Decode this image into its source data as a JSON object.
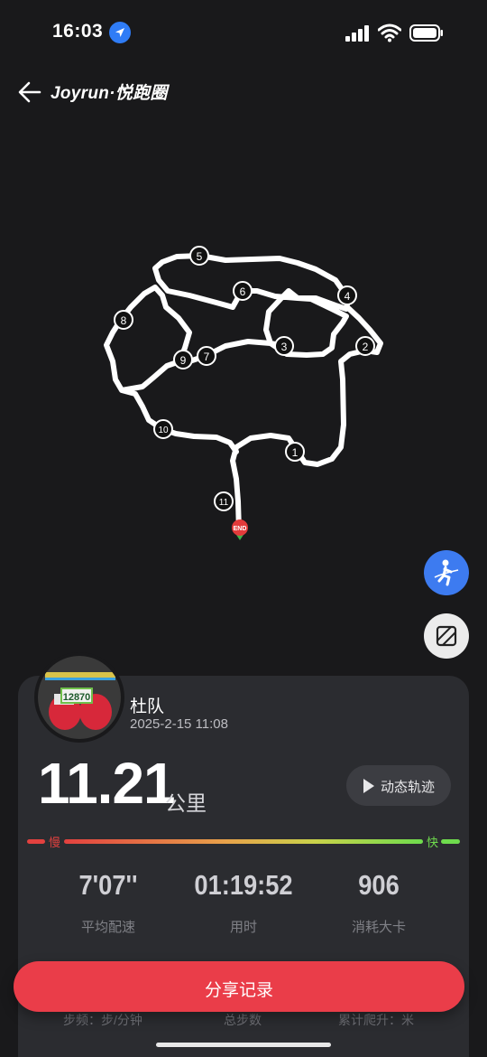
{
  "status": {
    "time": "16:03"
  },
  "nav": {
    "title": "Joyrun·悦跑圈"
  },
  "map": {
    "markers": [
      "1",
      "2",
      "3",
      "4",
      "5",
      "6",
      "7",
      "8",
      "9",
      "10",
      "11"
    ],
    "end_label": "END"
  },
  "user": {
    "name": "杜队",
    "date": "2025-2-15 11:08",
    "bib": "12870"
  },
  "run": {
    "distance": "11.21",
    "unit": "公里",
    "replay_label": "动态轨迹",
    "slow_label": "慢",
    "fast_label": "快"
  },
  "stats": [
    {
      "value": "7'07''",
      "label": "平均配速"
    },
    {
      "value": "01:19:52",
      "label": "用时"
    },
    {
      "value": "906",
      "label": "消耗大卡"
    }
  ],
  "stats_row2": [
    {
      "label": "步频：步/分钟"
    },
    {
      "label": "总步数"
    },
    {
      "label": "累计爬升：米"
    }
  ],
  "share": {
    "label": "分享记录"
  },
  "colors": {
    "accent": "#ea3d49",
    "fab_blue": "#3d7bf0",
    "slow": "#e3413f",
    "fast": "#6fdc4d"
  }
}
